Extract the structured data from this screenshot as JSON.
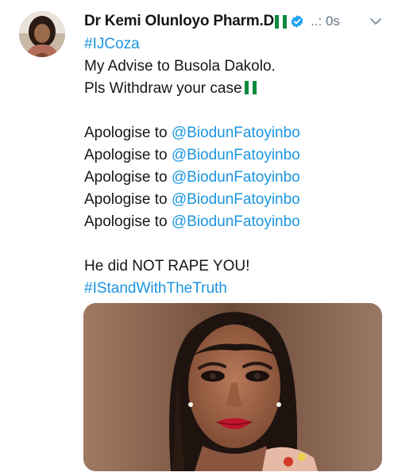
{
  "tweet": {
    "author": {
      "display_name": "Dr Kemi Olunloyo Pharm.D",
      "verified": true
    },
    "meta": "..: 0s",
    "lines": {
      "l1": "#IJCoza",
      "l2": "My Advise to Busola Dakolo.",
      "l3": "Pls Withdraw your case",
      "l4_prefix": "Apologise to ",
      "l4_mention": "@BiodunFatoyinbo",
      "l9": "He did NOT RAPE YOU!",
      "l10": "#IStandWithTheTruth"
    }
  },
  "colors": {
    "link": "#1b95e0",
    "verified": "#1da1f2",
    "flag_green": "#0c8a3b",
    "meta": "#657786"
  },
  "icons": {
    "verified": "verified-badge-icon",
    "caret": "chevron-down-icon",
    "flag": "nigeria-flag-icon"
  }
}
